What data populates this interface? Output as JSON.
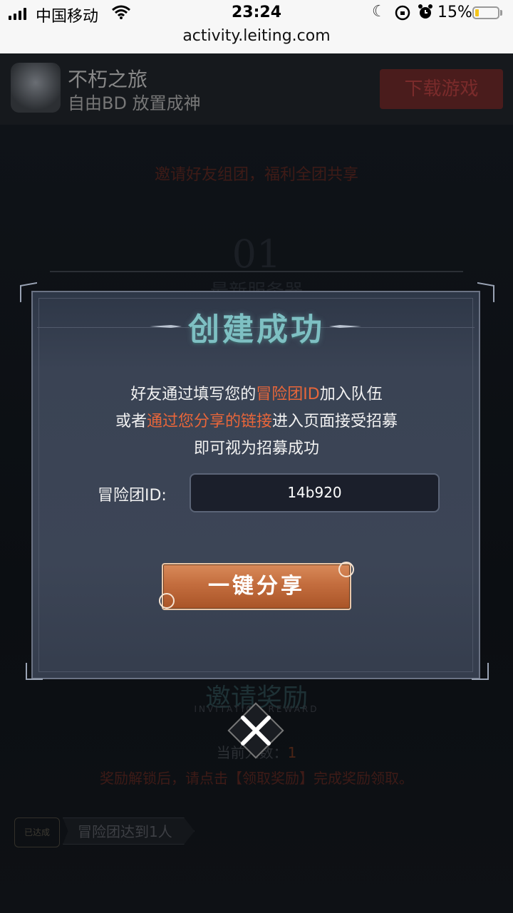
{
  "status_bar": {
    "carrier": "中国移动",
    "time": "23:24",
    "battery_percent": "15%",
    "url": "activity.leiting.com"
  },
  "app_banner": {
    "name": "不朽之旅",
    "slogan": "自由BD 放置成神",
    "download_label": "下载游戏"
  },
  "background": {
    "subtitle": "邀请好友组团，福利全团共享",
    "section_number": "01",
    "section_title": "最新服务器",
    "invite_title": "邀请奖励",
    "invite_title_en": "INVITATION REWARD",
    "count_label": "当前人数：",
    "count_value": "1",
    "tip": "奖励解锁后，请点击【领取奖励】完成奖励领取。",
    "task_badge": "已达成",
    "task_label": "冒险团达到1人"
  },
  "modal": {
    "title": "创建成功",
    "line1_pre": "好友通过填写您的",
    "line1_hl": "冒险团ID",
    "line1_post": "加入队伍",
    "line2_pre": "或者",
    "line2_hl": "通过您分享的链接",
    "line2_post": "进入页面接受招募",
    "line3": "即可视为招募成功",
    "id_label": "冒险团ID:",
    "id_value": "14b920",
    "share_label": "一键分享"
  },
  "colors": {
    "highlight": "#e8663a",
    "title": "#7ec0c3",
    "modal_bg": "#3a4354",
    "button": "#c36d3e"
  }
}
